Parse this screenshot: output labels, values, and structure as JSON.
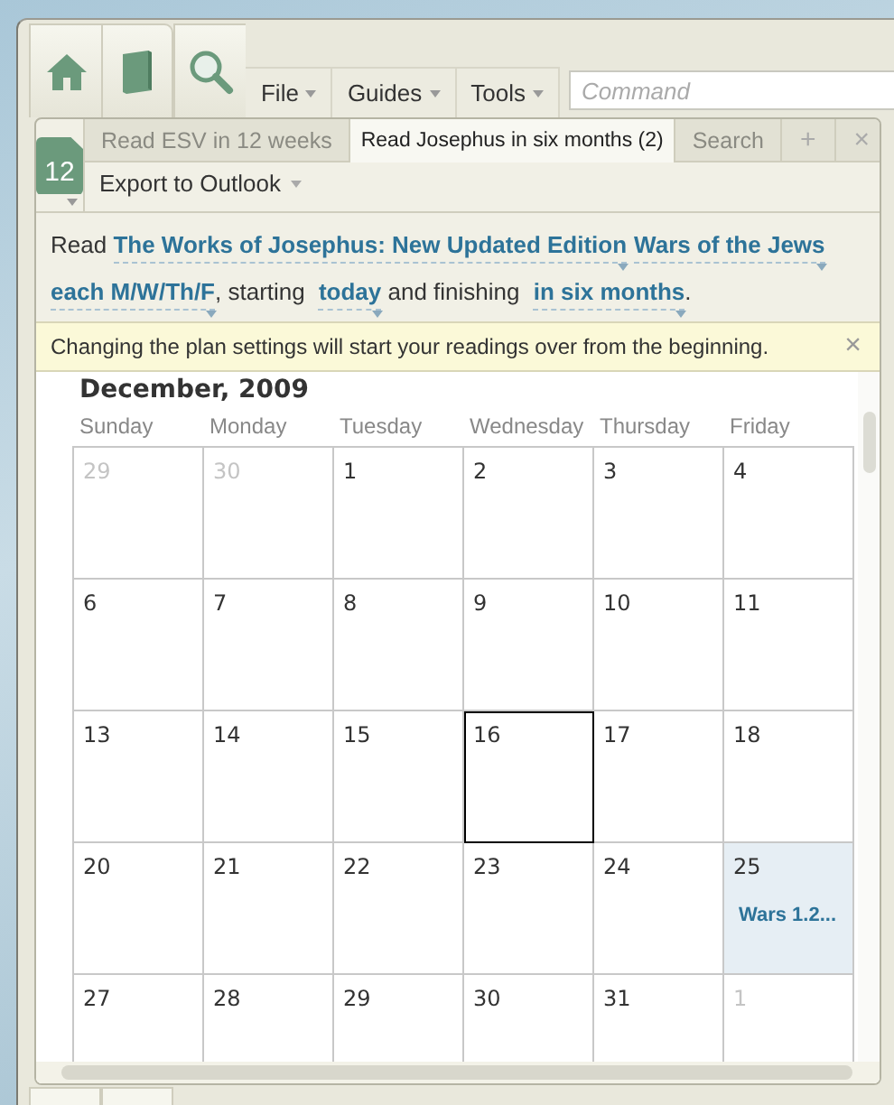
{
  "toolbar": {
    "buttons": [
      {
        "kind": "home"
      },
      {
        "kind": "book"
      },
      {
        "kind": "search"
      }
    ],
    "menus": [
      "File",
      "Guides",
      "Tools"
    ],
    "command": {
      "placeholder": "Command"
    }
  },
  "calendar_badge": "12",
  "tabs": [
    {
      "label": "Read ESV in 12 weeks",
      "selected": false
    },
    {
      "label": "Read Josephus in six months (2)",
      "selected": true
    },
    {
      "label": "Search",
      "selected": false
    }
  ],
  "tab_add": "+",
  "tab_close": "×",
  "action": "Export to Outlook",
  "plan_sentence": [
    {
      "kind": "text",
      "text": "Read "
    },
    {
      "kind": "choice",
      "text": "The Works of Josephus: New Updated Edition"
    },
    {
      "kind": "choice",
      "text": "Wars of the Jews"
    },
    {
      "kind": "break"
    },
    {
      "kind": "choice",
      "text": "each M/W/Th/F"
    },
    {
      "kind": "text",
      "text": ", starting "
    },
    {
      "kind": "choice",
      "text": "today"
    },
    {
      "kind": "text",
      "text": " and finishing "
    },
    {
      "kind": "choice",
      "text": "in six months"
    },
    {
      "kind": "text",
      "text": "."
    }
  ],
  "notice": {
    "text": "Changing the plan settings will start your readings over from the beginning.",
    "close": "×"
  },
  "calendar": {
    "title": "December, 2009",
    "weekdays": [
      "Sunday",
      "Monday",
      "Tuesday",
      "Wednesday",
      "Thursday",
      "Friday"
    ],
    "weeks": [
      [
        {
          "day": "29",
          "muted": true,
          "selected": false
        },
        {
          "day": "30",
          "muted": true,
          "selected": false
        },
        {
          "day": "1",
          "muted": false,
          "selected": false
        },
        {
          "day": "2",
          "muted": false,
          "selected": false
        },
        {
          "day": "3",
          "muted": false,
          "selected": false
        },
        {
          "day": "4",
          "muted": false,
          "selected": false
        }
      ],
      [
        {
          "day": "6",
          "muted": false,
          "selected": false
        },
        {
          "day": "7",
          "muted": false,
          "selected": false
        },
        {
          "day": "8",
          "muted": false,
          "selected": false
        },
        {
          "day": "9",
          "muted": false,
          "selected": false
        },
        {
          "day": "10",
          "muted": false,
          "selected": false
        },
        {
          "day": "11",
          "muted": false,
          "selected": false
        }
      ],
      [
        {
          "day": "13",
          "muted": false,
          "selected": false
        },
        {
          "day": "14",
          "muted": false,
          "selected": false
        },
        {
          "day": "15",
          "muted": false,
          "selected": false
        },
        {
          "day": "16",
          "muted": false,
          "selected": true
        },
        {
          "day": "17",
          "muted": false,
          "selected": false
        },
        {
          "day": "18",
          "muted": false,
          "selected": false
        }
      ],
      [
        {
          "day": "20",
          "muted": false,
          "selected": false
        },
        {
          "day": "21",
          "muted": false,
          "selected": false
        },
        {
          "day": "22",
          "muted": false,
          "selected": false
        },
        {
          "day": "23",
          "muted": false,
          "selected": false
        },
        {
          "day": "24",
          "muted": false,
          "selected": false
        },
        {
          "day": "25",
          "muted": false,
          "selected": false,
          "reading": "Wars 1.2..."
        }
      ],
      [
        {
          "day": "27",
          "muted": false,
          "selected": false
        },
        {
          "day": "28",
          "muted": false,
          "selected": false
        },
        {
          "day": "29",
          "muted": false,
          "selected": false
        },
        {
          "day": "30",
          "muted": false,
          "selected": false
        },
        {
          "day": "31",
          "muted": false,
          "selected": false
        },
        {
          "day": "1",
          "muted": true,
          "selected": false
        }
      ]
    ]
  }
}
